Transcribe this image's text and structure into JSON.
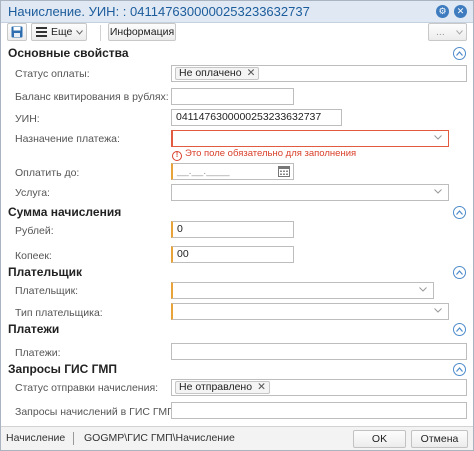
{
  "window": {
    "title": "Начисление. УИН: : 0411476300000253233632737"
  },
  "toolbar": {
    "more_label": "Еще",
    "info_label": "Информация",
    "overflow_label": "..."
  },
  "sections": {
    "main": {
      "title": "Основные свойства",
      "payment_status_label": "Статус оплаты:",
      "payment_status_value": "Не оплачено",
      "balance_label": "Баланс квитирования в рублях:",
      "balance_value": "",
      "uin_label": "УИН:",
      "uin_value": "0411476300000253233632737",
      "purpose_label": "Назначение платежа:",
      "purpose_value": "",
      "purpose_error": "Это поле обязательно для заполнения",
      "pay_by_label": "Оплатить до:",
      "pay_by_placeholder": "__.__.____",
      "service_label": "Услуга:",
      "service_value": ""
    },
    "amount": {
      "title": "Сумма начисления",
      "rubles_label": "Рублей:",
      "rubles_value": "0",
      "kopecks_label": "Копеек:",
      "kopecks_value": "00"
    },
    "payer": {
      "title": "Плательщик",
      "payer_label": "Плательщик:",
      "payer_value": "",
      "payer_type_label": "Тип плательщика:",
      "payer_type_value": ""
    },
    "payments": {
      "title": "Платежи",
      "payments_label": "Платежи:",
      "payments_value": ""
    },
    "gis": {
      "title": "Запросы ГИС ГМП",
      "send_status_label": "Статус отправки начисления:",
      "send_status_value": "Не отправлено",
      "requests_label": "Запросы начислений в ГИС ГМП:",
      "requests_value": ""
    }
  },
  "statusbar": {
    "entity": "Начисление",
    "path": "GOGMP\\ГИС ГМП\\Начисление",
    "ok_label": "OK",
    "cancel_label": "Отмена"
  },
  "colors": {
    "accent": "#1c5c9c",
    "required": "#e8a33b",
    "error": "#d9402a"
  },
  "icons": [
    "save-icon",
    "menu-icon",
    "chevron-down-icon",
    "settings-icon",
    "close-icon",
    "calendar-icon",
    "collapse-icon",
    "error-icon"
  ]
}
